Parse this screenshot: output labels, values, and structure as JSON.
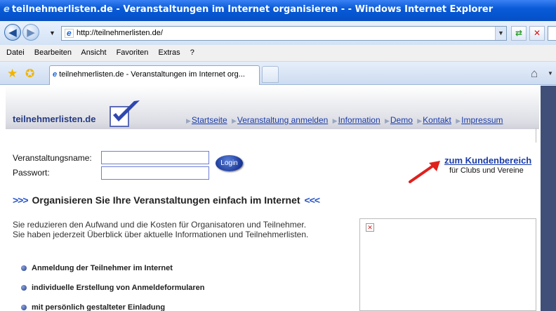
{
  "window": {
    "title": "teilnehmerlisten.de - Veranstaltungen im Internet organisieren - - Windows Internet Explorer"
  },
  "addressbar": {
    "url": "http://teilnehmerlisten.de/"
  },
  "menu": [
    "Datei",
    "Bearbeiten",
    "Ansicht",
    "Favoriten",
    "Extras",
    "?"
  ],
  "tabs": [
    {
      "label": "teilnehmerlisten.de - Veranstaltungen im Internet org..."
    }
  ],
  "site": {
    "logo": "teilnehmerlisten.de",
    "nav": [
      "Startseite",
      "Veranstaltung anmelden",
      "Information",
      "Demo",
      "Kontakt",
      "Impressum"
    ],
    "login": {
      "name_label": "Veranstaltungsname:",
      "password_label": "Passwort:",
      "button": "Login"
    },
    "customer_link": "zum Kundenbereich",
    "customer_sub": "für Clubs und Vereine",
    "headline_left": ">>>",
    "headline": "Organisieren Sie Ihre Veranstaltungen einfach im Internet",
    "headline_right": "<<<",
    "intro_line1": "Sie reduzieren den Aufwand und die Kosten für Organisatoren und Teilnehmer.",
    "intro_line2": "Sie haben jederzeit Überblick über aktuelle Informationen und Teilnehmerlisten.",
    "bullets": [
      "Anmeldung der Teilnehmer im Internet",
      "individuelle Erstellung von Anmeldeformularen",
      "mit persönlich gestalteter Einladung"
    ]
  },
  "colors": {
    "titlebar": "#0553cd",
    "link": "#1a3ba8",
    "accent_arrow": "#e0201c"
  }
}
